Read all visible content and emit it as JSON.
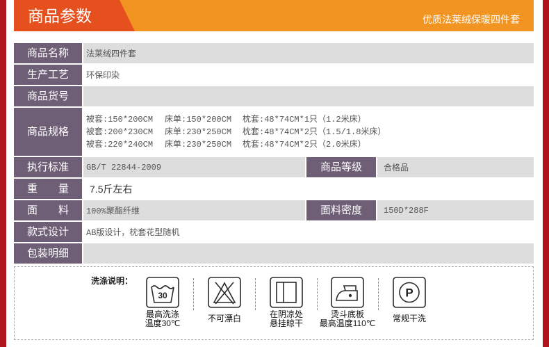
{
  "header": {
    "title": "商品参数",
    "subtitle": "优质法莱绒保暖四件套"
  },
  "params": {
    "name": {
      "label": "商品名称",
      "value": "法莱绒四件套"
    },
    "process": {
      "label": "生产工艺",
      "value": "环保印染"
    },
    "item_no": {
      "label": "商品货号"
    },
    "specs": {
      "label": "商品规格",
      "lines": [
        [
          "被套:150*200CM",
          "床单:150*200CM",
          "枕套:48*74CM*1只（1.2米床）"
        ],
        [
          "被套:200*230CM",
          "床单:230*250CM",
          "枕套:48*74CM*2只（1.5/1.8米床）"
        ],
        [
          "被套:220*240CM",
          "床单:230*250CM",
          "枕套:48*74CM*2只（2.0米床）"
        ]
      ]
    },
    "standard": {
      "label": "执行标准",
      "value": "GB/T 22844-2009"
    },
    "grade": {
      "label": "商品等级",
      "value": "合格品"
    },
    "weight": {
      "label": "重　　量",
      "value": "7.5斤左右"
    },
    "fabric": {
      "label": "面　　料",
      "value": "100%聚酯纤维"
    },
    "density": {
      "label": "面料密度",
      "value": "150D*288F"
    },
    "style": {
      "label": "款式设计",
      "value": "AB版设计，枕套花型随机"
    },
    "packing": {
      "label": "包装明细"
    }
  },
  "washing": {
    "title": "洗涤说明：",
    "items": [
      {
        "icon": "wash-30-icon",
        "symbol_text": "30",
        "lines": [
          "最高洗涤",
          "温度30℃"
        ]
      },
      {
        "icon": "no-bleach-icon",
        "lines": [
          "不可漂白"
        ]
      },
      {
        "icon": "drip-dry-shade-icon",
        "lines": [
          "在阴凉处",
          "悬挂晾干"
        ]
      },
      {
        "icon": "iron-icon",
        "lines": [
          "烫斗底板",
          "最高温度110℃"
        ]
      },
      {
        "icon": "dry-clean-icon",
        "symbol_text": "P",
        "lines": [
          "常规干洗"
        ]
      }
    ]
  },
  "colors": {
    "frame": "#b0141c",
    "header_tab": "#e6501e",
    "header_bar": "#f29421",
    "label_cell": "#6e5e76",
    "row_gray": "#dddddd",
    "value_text": "#555555"
  }
}
